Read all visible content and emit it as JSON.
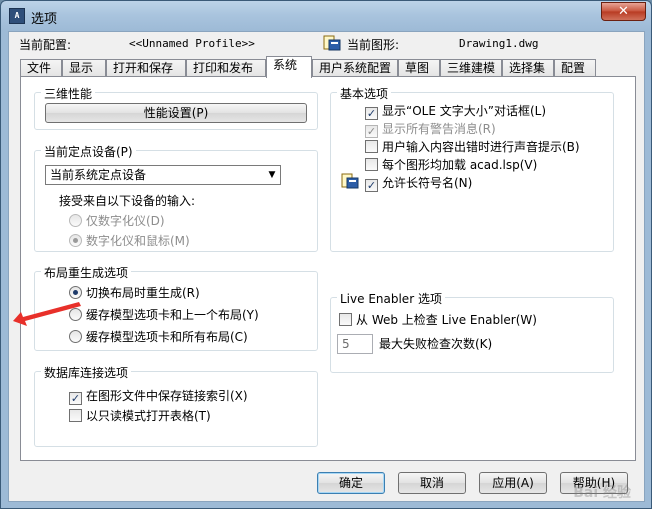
{
  "window": {
    "title": "选项",
    "app_icon_text": "A"
  },
  "config": {
    "current_profile_label": "当前配置:",
    "current_profile_value": "<<Unnamed Profile>>",
    "current_drawing_label": "当前图形:",
    "current_drawing_value": "Drawing1.dwg"
  },
  "tabs": [
    "文件",
    "显示",
    "打开和保存",
    "打印和发布",
    "系统",
    "用户系统配置",
    "草图",
    "三维建模",
    "选择集",
    "配置"
  ],
  "active_tab": "系统",
  "groups": {
    "performance": {
      "title": "三维性能",
      "button": "性能设置(P)"
    },
    "pointing": {
      "title": "当前定点设备(P)",
      "select_value": "当前系统定点设备",
      "accept_label": "接受来自以下设备的输入:",
      "options": [
        "仅数字化仪(D)",
        "数字化仪和鼠标(M)"
      ]
    },
    "layout_regen": {
      "title": "布局重生成选项",
      "options": [
        "切换布局时重生成(R)",
        "缓存模型选项卡和上一个布局(Y)",
        "缓存模型选项卡和所有布局(C)"
      ]
    },
    "db_connect": {
      "title": "数据库连接选项",
      "options": [
        "在图形文件中保存链接索引(X)",
        "以只读模式打开表格(T)"
      ]
    },
    "general": {
      "title": "基本选项",
      "options": [
        "显示“OLE 文字大小”对话框(L)",
        "显示所有警告消息(R)",
        "用户输入内容出错时进行声音提示(B)",
        "每个图形均加载 acad.lsp(V)",
        "允许长符号名(N)"
      ]
    },
    "live_enabler": {
      "title": "Live Enabler 选项",
      "check_web": "从 Web 上检查 Live Enabler(W)",
      "max_fail_value": "5",
      "max_fail_label": "最大失败检查次数(K)"
    }
  },
  "buttons": {
    "ok": "确定",
    "cancel": "取消",
    "apply": "应用(A)",
    "help": "帮助(H)"
  },
  "window_buttons": {
    "close": "✕"
  },
  "watermark": "Bai 经验"
}
